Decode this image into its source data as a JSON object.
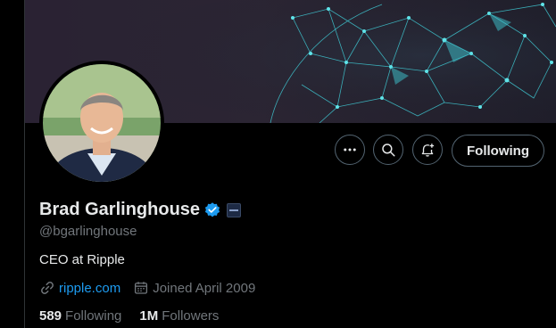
{
  "profile": {
    "display_name": "Brad Garlinghouse",
    "handle": "@bgarlinghouse",
    "bio": "CEO at Ripple",
    "website": "ripple.com",
    "joined": "Joined April 2009",
    "following_count": "589",
    "following_label": "Following",
    "followers_count": "1M",
    "followers_label": "Followers"
  },
  "actions": {
    "more_icon": "more-horizontal-icon",
    "search_icon": "search-icon",
    "notify_icon": "bell-plus-icon",
    "following_button_label": "Following"
  },
  "colors": {
    "accent_blue": "#1d9bf0",
    "verified_blue": "#1d9bf0",
    "muted_text": "#71767b",
    "border": "#536471",
    "background": "#000000"
  }
}
